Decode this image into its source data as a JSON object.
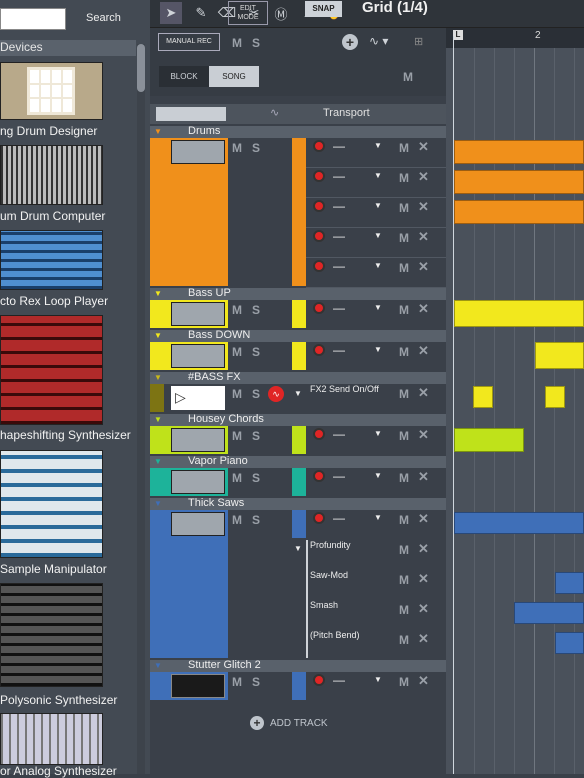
{
  "browser": {
    "search_label": "Search",
    "section_label": "Devices",
    "devices": [
      {
        "label": "ng Drum Designer"
      },
      {
        "label": "um Drum Computer"
      },
      {
        "label": "cto Rex Loop Player"
      },
      {
        "label": "hapeshifting Synthesizer"
      },
      {
        "label": "Sample Manipulator"
      },
      {
        "label": "Polysonic Synthesizer"
      },
      {
        "label": "or Analog Synthesizer"
      }
    ]
  },
  "toolbar": {
    "edit_mode_label": "EDIT MODE",
    "snap_label": "SNAP",
    "grid_label": "Grid (1/4)"
  },
  "sequencer": {
    "manual_rec_label": "MANUAL REC",
    "block_label": "BLOCK",
    "song_label": "SONG",
    "m_label": "M",
    "s_label": "S",
    "transport_label": "Transport",
    "ruler": {
      "marker_label": "L",
      "bar_label": "2"
    },
    "add_track_label": "ADD TRACK",
    "dash_label": "—",
    "x_label": "✕"
  },
  "tracks": [
    {
      "name": "Drums",
      "color": "#f0901b"
    },
    {
      "name": "Bass UP",
      "color": "#f2e81d"
    },
    {
      "name": "Bass DOWN",
      "color": "#f2e81d"
    },
    {
      "name": "#BASS FX",
      "color": "#7d7413",
      "param": "FX2 Send On/Off"
    },
    {
      "name": "Housey Chords",
      "color": "#bfe21a"
    },
    {
      "name": "Vapor Piano",
      "color": "#1db39a"
    },
    {
      "name": "Thick Saws",
      "color": "#3f6fb8",
      "params": [
        "Profundity",
        "Saw-Mod",
        "Smash",
        "(Pitch Bend)"
      ]
    },
    {
      "name": "Stutter Glitch 2",
      "color": "#3f6fb8"
    }
  ]
}
